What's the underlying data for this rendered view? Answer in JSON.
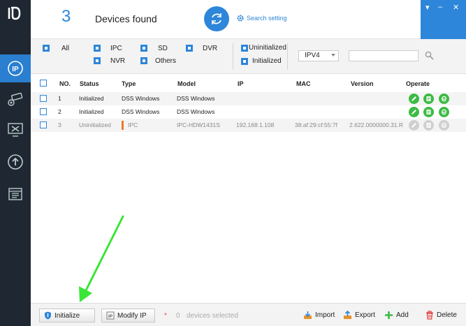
{
  "header": {
    "device_count": "3",
    "devices_found_label": "Devices found",
    "search_setting_label": "Search setting",
    "window_controls": [
      "▾",
      "–",
      "✕"
    ]
  },
  "sidebar": {
    "logo_text": "Ʊ",
    "items": [
      {
        "icon": "ip-icon"
      },
      {
        "icon": "camera-icon"
      },
      {
        "icon": "tools-icon"
      },
      {
        "icon": "upgrade-icon"
      },
      {
        "icon": "document-icon"
      }
    ]
  },
  "filter": {
    "all_label": "All",
    "ipc_label": "IPC",
    "sd_label": "SD",
    "dvr_label": "DVR",
    "nvr_label": "NVR",
    "others_label": "Others",
    "uninitialized_label": "Uninitialized",
    "initialized_label": "Initialized",
    "ip_version": "IPV4",
    "search_value": ""
  },
  "table": {
    "columns": [
      "NO.",
      "Status",
      "Type",
      "Model",
      "IP",
      "MAC",
      "Version",
      "Operate"
    ],
    "rows": [
      {
        "no": "1",
        "status": "Initialized",
        "type": "DSS Windows",
        "model": "DSS Windows",
        "ip": "",
        "mac": "",
        "version": ""
      },
      {
        "no": "2",
        "status": "Initialized",
        "type": "DSS Windows",
        "model": "DSS Windows",
        "ip": "",
        "mac": "",
        "version": ""
      },
      {
        "no": "3",
        "status": "Uninitialized",
        "type": "IPC",
        "model": "IPC-HDW1431S",
        "ip": "192.168.1.108",
        "mac": "38:af:29:cf:55:7f",
        "version": "2.622.0000000.31.R"
      }
    ]
  },
  "bottom": {
    "initialize_label": "Initialize",
    "modify_ip_label": "Modify IP",
    "selected_count": "0",
    "selected_text": "devices selected",
    "import_label": "Import",
    "export_label": "Export",
    "add_label": "Add",
    "delete_label": "Delete"
  },
  "colors": {
    "accent": "#2d86d9",
    "sidebar": "#1f2733",
    "op_green": "#3cbb44",
    "annotation_arrow": "#39e639"
  }
}
